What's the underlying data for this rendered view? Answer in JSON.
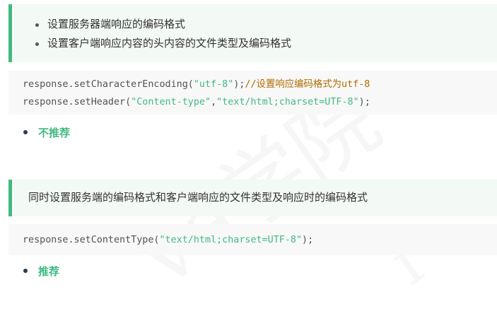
{
  "callout1": {
    "items": [
      "设置服务器端响应的编码格式",
      "设置客户端响应内容的头内容的文件类型及编码格式"
    ]
  },
  "code1": {
    "line1": {
      "prefix": "response.setCharacterEncoding(",
      "string": "\"utf-8\"",
      "suffix": ");",
      "comment": "//设置响应编码格式为utf-8"
    },
    "line2": {
      "prefix": "response.setHeader(",
      "string1": "\"Content-type\"",
      "comma": ",",
      "string2": "\"text/html;charset=UTF-8\"",
      "suffix": ");"
    }
  },
  "rec1": {
    "label": "不推荐"
  },
  "callout2": {
    "text": "同时设置服务端的编码格式和客户端响应的文件类型及响应时的编码格式"
  },
  "code2": {
    "line1": {
      "prefix": "response.setContentType(",
      "string": "\"text/html;charset=UTF-8\"",
      "suffix": ");"
    }
  },
  "rec2": {
    "label": "推荐"
  },
  "colors": {
    "accent": "#42b983",
    "comment": "#b06c00",
    "callout_bg": "#f3f9f5",
    "code_bg": "#f8f8f8"
  }
}
